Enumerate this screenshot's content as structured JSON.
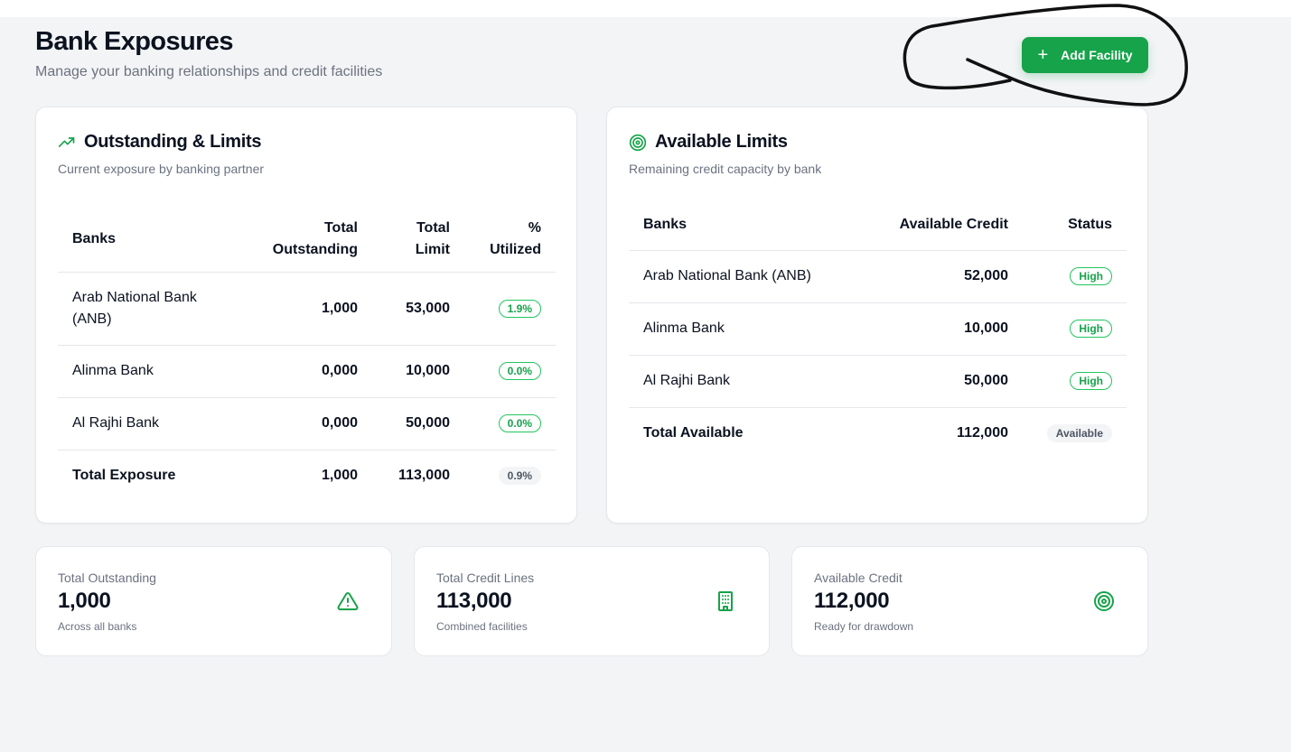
{
  "header": {
    "title": "Bank Exposures",
    "subtitle": "Manage your banking relationships and credit facilities",
    "add_button_label": "Add Facility"
  },
  "outstanding": {
    "title": "Outstanding & Limits",
    "description": "Current exposure by banking partner",
    "icon": "trending-up-icon",
    "columns": {
      "bank": "Banks",
      "outstanding_l1": "Total",
      "outstanding_l2": "Outstanding",
      "limit_l1": "Total",
      "limit_l2": "Limit",
      "util_l1": "%",
      "util_l2": "Utilized"
    },
    "rows": [
      {
        "bank_l1": "Arab National Bank",
        "bank_l2": "(ANB)",
        "outstanding": "1,000",
        "limit": "53,000",
        "utilized": "1.9%"
      },
      {
        "bank": "Alinma Bank",
        "outstanding": "0,000",
        "limit": "10,000",
        "utilized": "0.0%"
      },
      {
        "bank": "Al Rajhi Bank",
        "outstanding": "0,000",
        "limit": "50,000",
        "utilized": "0.0%"
      }
    ],
    "total": {
      "label": "Total Exposure",
      "outstanding": "1,000",
      "limit": "113,000",
      "utilized": "0.9%"
    }
  },
  "available": {
    "title": "Available Limits",
    "description": "Remaining credit capacity by bank",
    "icon": "target-icon",
    "columns": {
      "bank": "Banks",
      "credit": "Available Credit",
      "status": "Status"
    },
    "rows": [
      {
        "bank": "Arab National Bank (ANB)",
        "credit": "52,000",
        "status": "High"
      },
      {
        "bank": "Alinma Bank",
        "credit": "10,000",
        "status": "High"
      },
      {
        "bank": "Al Rajhi Bank",
        "credit": "50,000",
        "status": "High"
      }
    ],
    "total": {
      "label": "Total Available",
      "credit": "112,000",
      "status": "Available"
    }
  },
  "stats": [
    {
      "label": "Total Outstanding",
      "value": "1,000",
      "sub": "Across all banks",
      "icon": "alert-triangle-icon"
    },
    {
      "label": "Total Credit Lines",
      "value": "113,000",
      "sub": "Combined facilities",
      "icon": "building-icon"
    },
    {
      "label": "Available Credit",
      "value": "112,000",
      "sub": "Ready for drawdown",
      "icon": "target-icon"
    }
  ],
  "colors": {
    "accent": "#16a34a",
    "background": "#f3f4f6",
    "text": "#0b1220",
    "muted": "#6b7280"
  }
}
